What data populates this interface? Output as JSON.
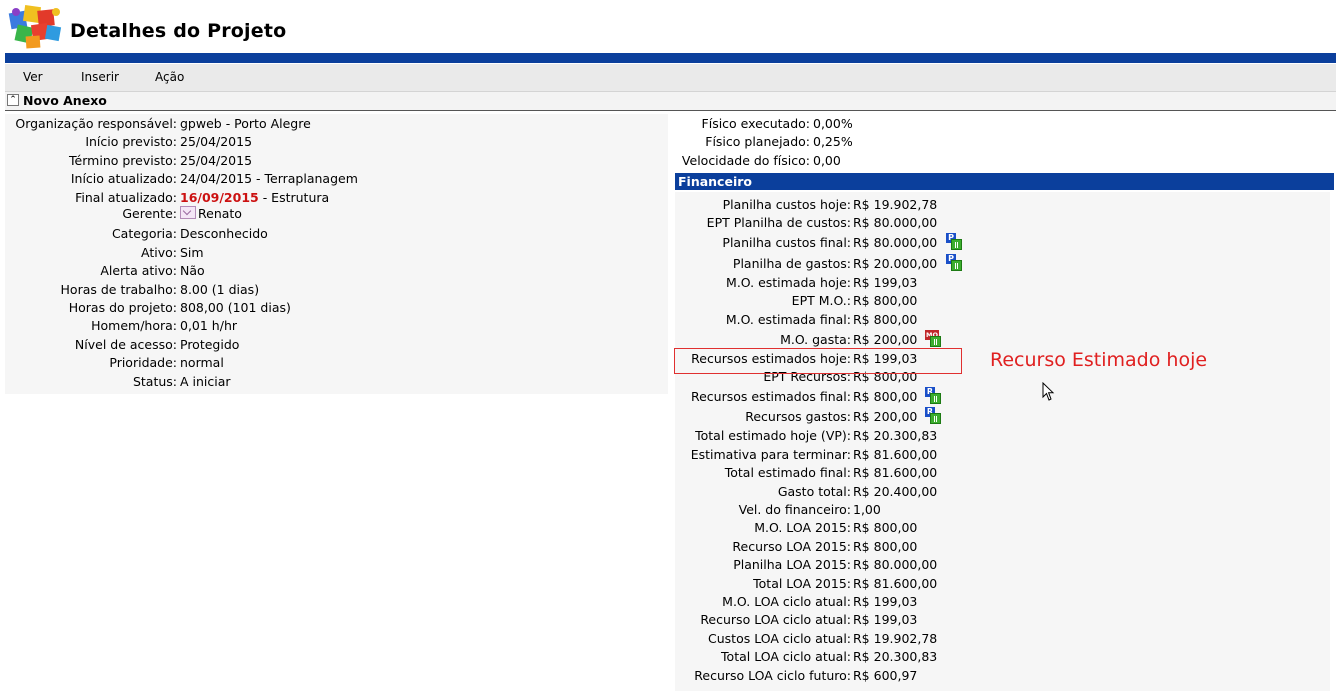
{
  "header": {
    "title": "Detalhes do Projeto"
  },
  "menu": {
    "items": [
      "Ver",
      "Inserir",
      "Ação"
    ]
  },
  "section": {
    "title": "Novo Anexo"
  },
  "details": [
    {
      "label": "Organização responsável:",
      "value": "gpweb - Porto Alegre"
    },
    {
      "label": "Início previsto:",
      "value": "25/04/2015"
    },
    {
      "label": "Término previsto:",
      "value": "25/04/2015"
    },
    {
      "label": "Início atualizado:",
      "value": "24/04/2015 - Terraplanagem"
    },
    {
      "label": "Final atualizado:",
      "value_date": "16/09/2015",
      "value_rest": " - Estrutura"
    },
    {
      "label": "Gerente:",
      "value": "Renato"
    },
    {
      "label": "Categoria:",
      "value": "Desconhecido"
    },
    {
      "label": "Ativo:",
      "value": "Sim"
    },
    {
      "label": "Alerta ativo:",
      "value": "Não"
    },
    {
      "label": "Horas de trabalho:",
      "value": "8.00 (1 dias)"
    },
    {
      "label": "Horas do projeto:",
      "value": "808,00 (101 dias)"
    },
    {
      "label": "Homem/hora:",
      "value": "0,01 h/hr"
    },
    {
      "label": "Nível de acesso:",
      "value": "Protegido"
    },
    {
      "label": "Prioridade:",
      "value": "normal"
    },
    {
      "label": "Status:",
      "value": "A iniciar"
    }
  ],
  "physical": [
    {
      "label": "Físico executado:",
      "value": "0,00%"
    },
    {
      "label": "Físico planejado:",
      "value": "0,25%"
    },
    {
      "label": "Velocidade do físico:",
      "value": "0,00"
    }
  ],
  "financial": {
    "title": "Financeiro",
    "rows": [
      {
        "label": "Planilha custos hoje:",
        "value": "R$ 19.902,78"
      },
      {
        "label": "EPT Planilha de custos:",
        "value": "R$ 80.000,00"
      },
      {
        "label": "Planilha custos final:",
        "value": "R$ 80.000,00",
        "icon": "P"
      },
      {
        "label": "Planilha de gastos:",
        "value": "R$ 20.000,00",
        "icon": "P"
      },
      {
        "label": "M.O. estimada hoje:",
        "value": "R$ 199,03"
      },
      {
        "label": "EPT M.O.:",
        "value": "R$ 800,00"
      },
      {
        "label": "M.O. estimada final:",
        "value": "R$ 800,00"
      },
      {
        "label": "M.O. gasta:",
        "value": "R$ 200,00",
        "icon": "MO"
      },
      {
        "label": "Recursos estimados hoje:",
        "value": "R$ 199,03"
      },
      {
        "label": "EPT Recursos:",
        "value": "R$ 800,00"
      },
      {
        "label": "Recursos estimados final:",
        "value": "R$ 800,00",
        "icon": "R"
      },
      {
        "label": "Recursos gastos:",
        "value": "R$ 200,00",
        "icon": "R"
      },
      {
        "label": "Total estimado hoje (VP):",
        "value": "R$ 20.300,83"
      },
      {
        "label": "Estimativa para terminar:",
        "value": "R$ 81.600,00"
      },
      {
        "label": "Total estimado final:",
        "value": "R$ 81.600,00"
      },
      {
        "label": "Gasto total:",
        "value": "R$ 20.400,00"
      },
      {
        "label": "Vel. do financeiro:",
        "value": "1,00"
      },
      {
        "label": "M.O. LOA 2015:",
        "value": "R$ 800,00"
      },
      {
        "label": "Recurso LOA 2015:",
        "value": "R$ 800,00"
      },
      {
        "label": "Planilha LOA 2015:",
        "value": "R$ 80.000,00"
      },
      {
        "label": "Total LOA 2015:",
        "value": "R$ 81.600,00"
      },
      {
        "label": "M.O. LOA ciclo atual:",
        "value": "R$ 199,03"
      },
      {
        "label": "Recurso LOA ciclo atual:",
        "value": "R$ 199,03"
      },
      {
        "label": "Custos LOA ciclo atual:",
        "value": "R$ 19.902,78"
      },
      {
        "label": "Total LOA ciclo atual:",
        "value": "R$ 20.300,83"
      },
      {
        "label": "Recurso LOA ciclo futuro:",
        "value": "R$ 600,97"
      }
    ]
  },
  "annotation": {
    "text": "Recurso Estimado hoje"
  },
  "colors": {
    "accent_blue": "#0b3f9c",
    "highlight_red": "#e03030",
    "date_red": "#cc1111"
  }
}
